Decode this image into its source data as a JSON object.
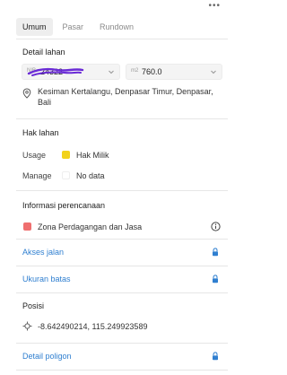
{
  "toolbar": {
    "more_label": "•••"
  },
  "tabs": [
    {
      "label": "Umum",
      "active": true
    },
    {
      "label": "Pasar",
      "active": false
    },
    {
      "label": "Rundown",
      "active": false
    }
  ],
  "detail_lahan": {
    "title": "Detail lahan",
    "nib": {
      "prefix": "NIB",
      "value": "24322"
    },
    "area": {
      "prefix": "m2",
      "value": "760.0"
    },
    "address": "Kesiman Kertalangu, Denpasar Timur, Denpasar, Bali"
  },
  "hak_lahan": {
    "title": "Hak lahan",
    "usage_label": "Usage",
    "usage_value": "Hak Milik",
    "usage_color": "#f2d21b",
    "manage_label": "Manage",
    "manage_value": "No data"
  },
  "informasi_perencanaan": {
    "title": "Informasi perencanaan",
    "zone_label": "Zona Perdagangan dan Jasa",
    "zone_color": "#ef6f6f"
  },
  "links": {
    "akses_jalan": "Akses jalan",
    "ukuran_batas": "Ukuran batas",
    "detail_poligon": "Detail poligon",
    "color": "#2f7fd0"
  },
  "posisi": {
    "title": "Posisi",
    "coordinates": "-8.642490214, 115.249923589"
  }
}
